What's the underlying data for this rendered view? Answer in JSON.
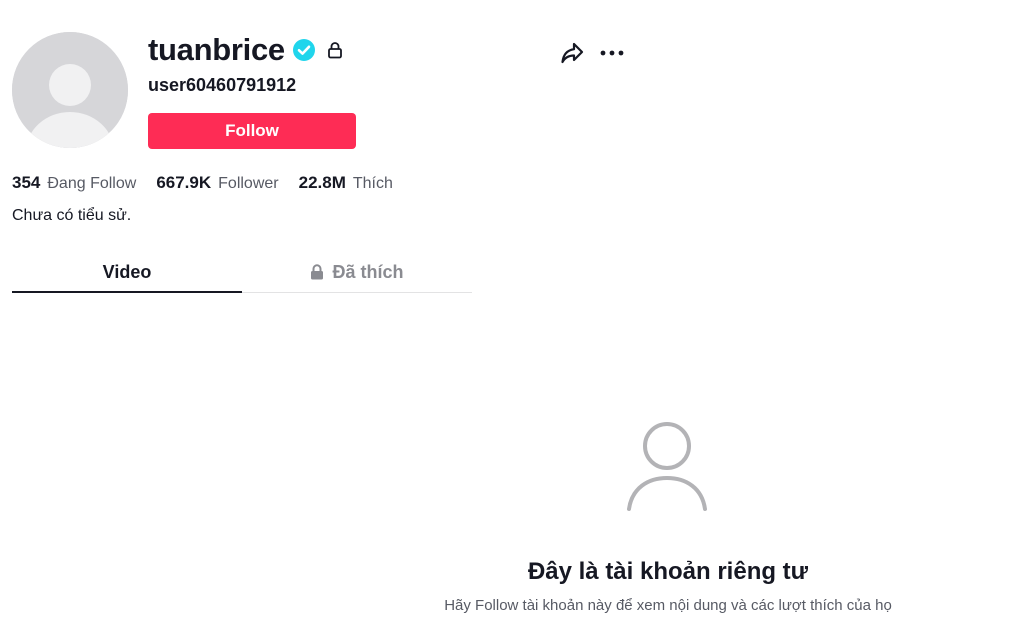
{
  "profile": {
    "username": "tuanbrice",
    "nickname": "user60460791912",
    "follow_label": "Follow",
    "bio": "Chưa có tiểu sử."
  },
  "stats": [
    {
      "value": "354",
      "label": "Đang Follow"
    },
    {
      "value": "667.9K",
      "label": "Follower"
    },
    {
      "value": "22.8M",
      "label": "Thích"
    }
  ],
  "tabs": [
    {
      "label": "Video",
      "active": true
    },
    {
      "label": "Đã thích",
      "active": false,
      "locked": true
    }
  ],
  "private_notice": {
    "title": "Đây là tài khoản riêng tư",
    "description": "Hãy Follow tài khoản này để xem nội dung và các lượt thích của họ"
  },
  "colors": {
    "accent": "#fe2c55",
    "verified": "#20d5ec",
    "text_primary": "#161823",
    "text_secondary": "#575a64"
  },
  "icons": {
    "verified": "verified-badge-icon",
    "lock": "lock-icon",
    "share": "share-icon",
    "more": "more-options-icon",
    "private_user": "user-outline-icon"
  }
}
